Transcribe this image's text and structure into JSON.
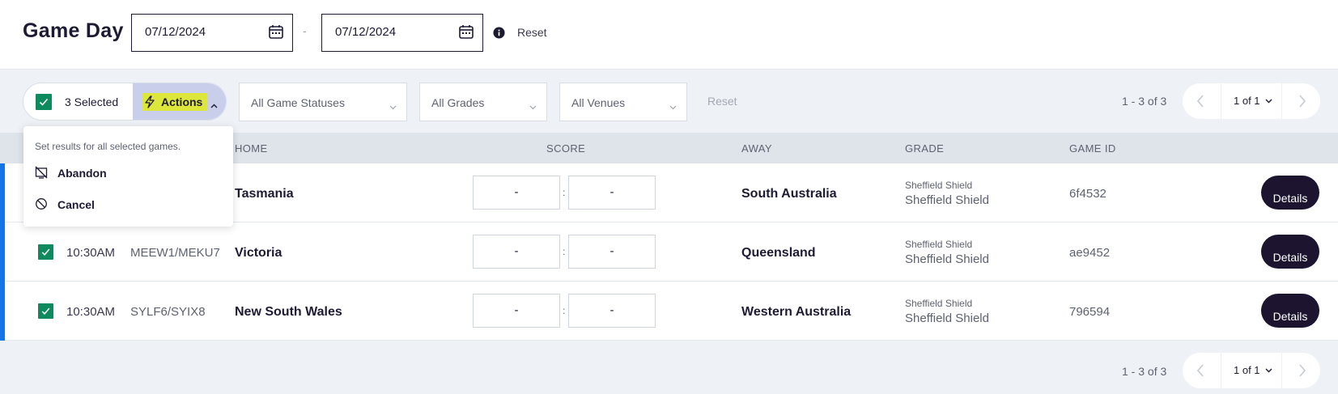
{
  "header": {
    "title": "Game Day",
    "date_from": "07/12/2024",
    "date_to": "07/12/2024",
    "separator": "-",
    "reset_label": "Reset"
  },
  "filters": {
    "selected_label": "3 Selected",
    "actions_label": "Actions",
    "status_placeholder": "All Game Statuses",
    "grades_placeholder": "All Grades",
    "venues_placeholder": "All Venues",
    "reset_label": "Reset"
  },
  "pagination": {
    "count": "1 - 3 of 3",
    "page": "1 of 1"
  },
  "actions_menu": {
    "heading": "Set results for all selected games.",
    "items": [
      {
        "label": "Abandon",
        "icon": "abandon-icon"
      },
      {
        "label": "Cancel",
        "icon": "cancel-icon"
      }
    ]
  },
  "table": {
    "headers": {
      "home": "HOME",
      "score": "SCORE",
      "away": "AWAY",
      "grade": "GRADE",
      "game_id": "GAME ID"
    },
    "rows": [
      {
        "time": "",
        "code": "",
        "home": "Tasmania",
        "home_score": "-",
        "away_score": "-",
        "colon": ":",
        "away": "South Australia",
        "grade_small": "Sheffield Shield",
        "grade": "Sheffield Shield",
        "game_id": "6f4532",
        "details": "Details"
      },
      {
        "time": "10:30AM",
        "code": "MEEW1/MEKU7",
        "home": "Victoria",
        "home_score": "-",
        "away_score": "-",
        "colon": ":",
        "away": "Queensland",
        "grade_small": "Sheffield Shield",
        "grade": "Sheffield Shield",
        "game_id": "ae9452",
        "details": "Details"
      },
      {
        "time": "10:30AM",
        "code": "SYLF6/SYIX8",
        "home": "New South Wales",
        "home_score": "-",
        "away_score": "-",
        "colon": ":",
        "away": "Western Australia",
        "grade_small": "Sheffield Shield",
        "grade": "Sheffield Shield",
        "game_id": "796594",
        "details": "Details"
      }
    ]
  },
  "colors": {
    "accent": "#1473e6",
    "checkbox": "#0e8a5f",
    "dark": "#1d1430",
    "highlight": "#dde63a"
  }
}
